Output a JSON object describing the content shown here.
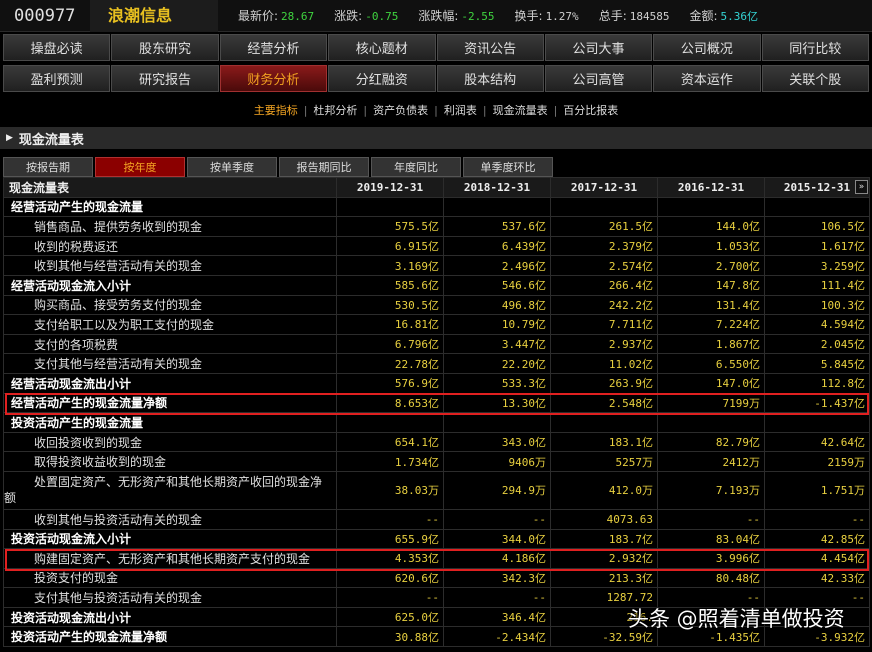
{
  "header": {
    "code": "000977",
    "name": "浪潮信息",
    "quotes": [
      {
        "label": "最新价:",
        "value": "28.67",
        "color": "green"
      },
      {
        "label": "涨跌:",
        "value": "-0.75",
        "color": "green"
      },
      {
        "label": "涨跌幅:",
        "value": "-2.55",
        "color": "green"
      },
      {
        "label": "换手:",
        "value": "1.27%",
        "color": "white"
      },
      {
        "label": "总手:",
        "value": "184585",
        "color": "white"
      },
      {
        "label": "金额:",
        "value": "5.36亿",
        "color": "cyan"
      }
    ]
  },
  "nav_row1": [
    "操盘必读",
    "股东研究",
    "经营分析",
    "核心题材",
    "资讯公告",
    "公司大事",
    "公司概况",
    "同行比较"
  ],
  "nav_row2": [
    "盈利预测",
    "研究报告",
    "财务分析",
    "分红融资",
    "股本结构",
    "公司高管",
    "资本运作",
    "关联个股"
  ],
  "nav_active": "财务分析",
  "subnav": [
    "主要指标",
    "杜邦分析",
    "资产负债表",
    "利润表",
    "现金流量表",
    "百分比报表"
  ],
  "subnav_active": "主要指标",
  "section_title": "现金流量表",
  "tabs": [
    "按报告期",
    "按年度",
    "按单季度",
    "报告期同比",
    "年度同比",
    "单季度环比"
  ],
  "tab_active": "按年度",
  "table": {
    "headers": [
      "现金流量表",
      "2019-12-31",
      "2018-12-31",
      "2017-12-31",
      "2016-12-31",
      "2015-12-31"
    ],
    "rows": [
      {
        "label": "经营活动产生的现金流量",
        "values": [
          "",
          "",
          "",
          "",
          ""
        ],
        "type": "header"
      },
      {
        "label": "销售商品、提供劳务收到的现金",
        "values": [
          "575.5亿",
          "537.6亿",
          "261.5亿",
          "144.0亿",
          "106.5亿"
        ],
        "type": "item"
      },
      {
        "label": "收到的税费返还",
        "values": [
          "6.915亿",
          "6.439亿",
          "2.379亿",
          "1.053亿",
          "1.617亿"
        ],
        "type": "item"
      },
      {
        "label": "收到其他与经营活动有关的现金",
        "values": [
          "3.169亿",
          "2.496亿",
          "2.574亿",
          "2.700亿",
          "3.259亿"
        ],
        "type": "item"
      },
      {
        "label": "经营活动现金流入小计",
        "values": [
          "585.6亿",
          "546.6亿",
          "266.4亿",
          "147.8亿",
          "111.4亿"
        ],
        "type": "header"
      },
      {
        "label": "购买商品、接受劳务支付的现金",
        "values": [
          "530.5亿",
          "496.8亿",
          "242.2亿",
          "131.4亿",
          "100.3亿"
        ],
        "type": "item"
      },
      {
        "label": "支付给职工以及为职工支付的现金",
        "values": [
          "16.81亿",
          "10.79亿",
          "7.711亿",
          "7.224亿",
          "4.594亿"
        ],
        "type": "item"
      },
      {
        "label": "支付的各项税费",
        "values": [
          "6.796亿",
          "3.447亿",
          "2.937亿",
          "1.867亿",
          "2.045亿"
        ],
        "type": "item"
      },
      {
        "label": "支付其他与经营活动有关的现金",
        "values": [
          "22.78亿",
          "22.20亿",
          "11.02亿",
          "6.550亿",
          "5.845亿"
        ],
        "type": "item"
      },
      {
        "label": "经营活动现金流出小计",
        "values": [
          "576.9亿",
          "533.3亿",
          "263.9亿",
          "147.0亿",
          "112.8亿"
        ],
        "type": "header"
      },
      {
        "label": "经营活动产生的现金流量净额",
        "values": [
          "8.653亿",
          "13.30亿",
          "2.548亿",
          "7199万",
          "-1.437亿"
        ],
        "type": "header"
      },
      {
        "label": "投资活动产生的现金流量",
        "values": [
          "",
          "",
          "",
          "",
          ""
        ],
        "type": "header"
      },
      {
        "label": "收回投资收到的现金",
        "values": [
          "654.1亿",
          "343.0亿",
          "183.1亿",
          "82.79亿",
          "42.64亿"
        ],
        "type": "item"
      },
      {
        "label": "取得投资收益收到的现金",
        "values": [
          "1.734亿",
          "9406万",
          "5257万",
          "2412万",
          "2159万"
        ],
        "type": "item"
      },
      {
        "label": "处置固定资产、无形资产和其他长期资产收回的现金净额",
        "values": [
          "38.03万",
          "294.9万",
          "412.0万",
          "7.193万",
          "1.751万"
        ],
        "type": "item",
        "tall": true
      },
      {
        "label": "收到其他与投资活动有关的现金",
        "values": [
          "--",
          "--",
          "4073.63",
          "--",
          "--"
        ],
        "type": "item"
      },
      {
        "label": "投资活动现金流入小计",
        "values": [
          "655.9亿",
          "344.0亿",
          "183.7亿",
          "83.04亿",
          "42.85亿"
        ],
        "type": "header"
      },
      {
        "label": "购建固定资产、无形资产和其他长期资产支付的现金",
        "values": [
          "4.353亿",
          "4.186亿",
          "2.932亿",
          "3.996亿",
          "4.454亿"
        ],
        "type": "item"
      },
      {
        "label": "投资支付的现金",
        "values": [
          "620.6亿",
          "342.3亿",
          "213.3亿",
          "80.48亿",
          "42.33亿"
        ],
        "type": "item"
      },
      {
        "label": "支付其他与投资活动有关的现金",
        "values": [
          "--",
          "--",
          "1287.72",
          "--",
          "--"
        ],
        "type": "item"
      },
      {
        "label": "投资活动现金流出小计",
        "values": [
          "625.0亿",
          "346.4亿",
          "216.",
          "",
          ""
        ],
        "type": "header"
      },
      {
        "label": "投资活动产生的现金流量净额",
        "values": [
          "30.88亿",
          "-2.434亿",
          "-32.59亿",
          "-1.435亿",
          "-3.932亿"
        ],
        "type": "header"
      }
    ]
  },
  "more_icon": "»",
  "watermark": "头条 @照着清单做投资"
}
